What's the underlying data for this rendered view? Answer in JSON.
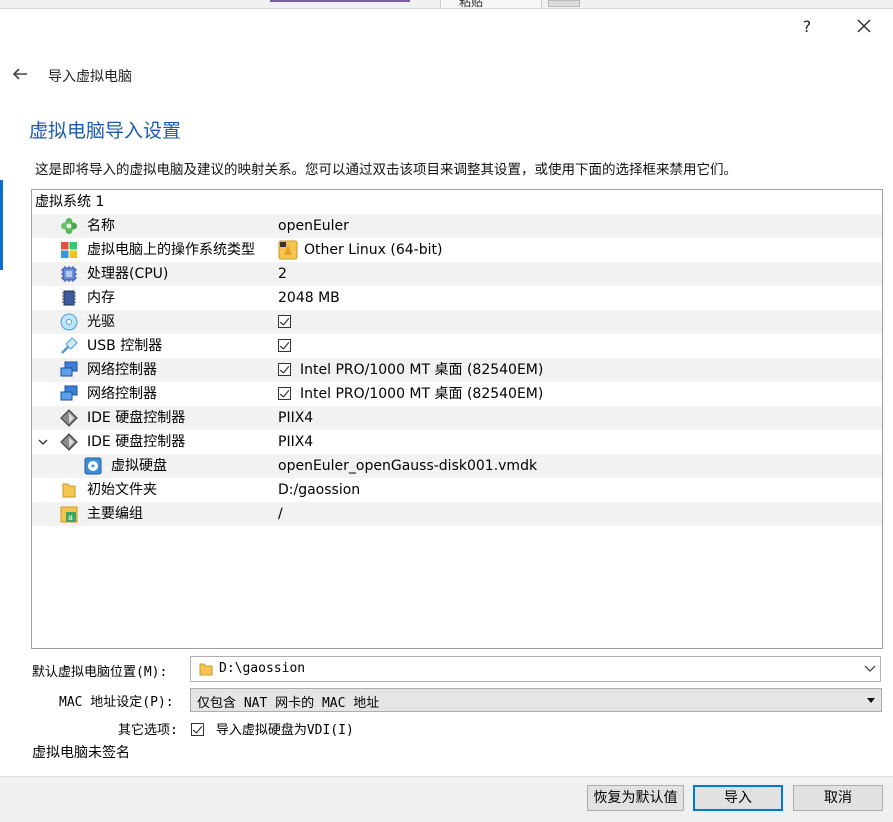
{
  "background_window": {
    "tab_label": "粘贴"
  },
  "window": {
    "help_label": "?",
    "nav_title": "导入虚拟电脑",
    "heading": "虚拟电脑导入设置"
  },
  "description": "这是即将导入的虚拟电脑及建议的映射关系。您可以通过双击该项目来调整其设置，或使用下面的选择框来禁用它们。",
  "tree": {
    "system_label": "虚拟系统 1",
    "rows": [
      {
        "label": "名称",
        "value": "openEuler",
        "icon": "name-icon"
      },
      {
        "label": "虚拟电脑上的操作系统类型",
        "value": "Other Linux (64-bit)",
        "icon": "os-type-icon"
      },
      {
        "label": "处理器(CPU)",
        "value": "2",
        "icon": "cpu-icon"
      },
      {
        "label": "内存",
        "value": "2048 MB",
        "icon": "memory-icon"
      },
      {
        "label": "光驱",
        "checked": true,
        "icon": "optical-drive-icon"
      },
      {
        "label": "USB 控制器",
        "checked": true,
        "icon": "usb-icon"
      },
      {
        "label": "网络控制器",
        "value": "Intel PRO/1000 MT 桌面 (82540EM)",
        "checked": true,
        "icon": "network-icon"
      },
      {
        "label": "网络控制器",
        "value": "Intel PRO/1000 MT 桌面 (82540EM)",
        "checked": true,
        "icon": "network-icon"
      },
      {
        "label": "IDE 硬盘控制器",
        "value": "PIIX4",
        "icon": "ide-controller-icon"
      },
      {
        "label": "IDE 硬盘控制器",
        "value": "PIIX4",
        "icon": "ide-controller-icon",
        "expanded": true
      },
      {
        "label": "虚拟硬盘",
        "value": "openEuler_openGauss-disk001.vmdk",
        "icon": "hard-disk-icon"
      },
      {
        "label": "初始文件夹",
        "value": "D:/gaossion",
        "icon": "folder-icon"
      },
      {
        "label": "主要编组",
        "value": "/",
        "icon": "group-icon"
      }
    ]
  },
  "form": {
    "location_label": "默认虚拟电脑位置(M):",
    "location_value": "D:\\gaossion",
    "mac_label": "MAC 地址设定(P):",
    "mac_value": "仅包含 NAT 网卡的 MAC 地址",
    "other_label": "其它选项:",
    "vdi_label": "导入虚拟硬盘为VDI(I)",
    "vdi_checked": true,
    "unsigned_note": "虚拟电脑未签名"
  },
  "buttons": {
    "restore": "恢复为默认值",
    "import": "导入",
    "cancel": "取消"
  },
  "colors": {
    "heading": "#1a5cb1",
    "accent": "#0078d7"
  }
}
